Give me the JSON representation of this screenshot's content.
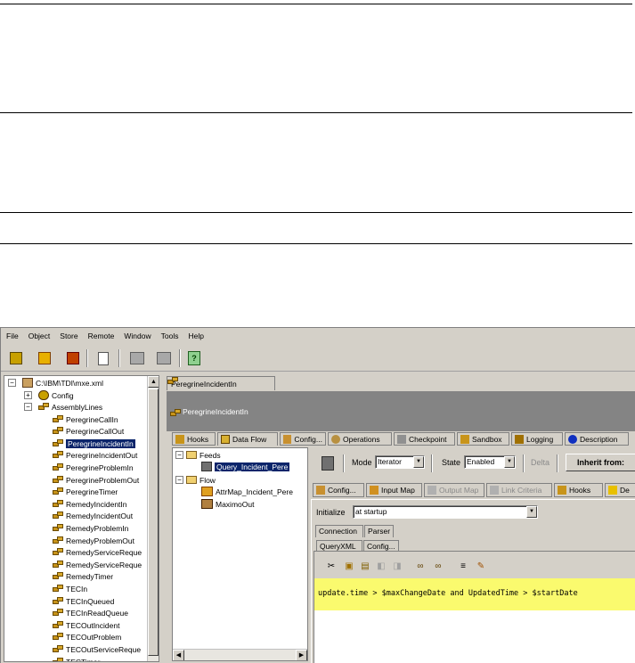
{
  "menu": [
    "File",
    "Object",
    "Store",
    "Remote",
    "Window",
    "Tools",
    "Help"
  ],
  "tree": {
    "root": "C:\\IBM\\TDI\\mxe.xml",
    "config": "Config",
    "assemblylines": "AssemblyLines",
    "items": [
      "PeregrineCallIn",
      "PeregrineCallOut",
      "PeregrineIncidentIn",
      "PeregrineIncidentOut",
      "PeregrineProblemIn",
      "PeregrineProblemOut",
      "PeregrineTimer",
      "RemedyIncidentIn",
      "RemedyIncidentOut",
      "RemedyProblemIn",
      "RemedyProblemOut",
      "RemedyServiceReque",
      "RemedyServiceReque",
      "RemedyTimer",
      "TECIn",
      "TECInQueued",
      "TECInReadQueue",
      "TECOutIncident",
      "TECOutProblem",
      "TECOutServiceReque",
      "TECTimer"
    ],
    "selected_index": 2
  },
  "editor_tab": "PeregrineIncidentIn",
  "header_title": "PeregrineIncidentIn",
  "main_tabs": [
    "Hooks",
    "Data Flow",
    "Config...",
    "Operations",
    "Checkpoint",
    "Sandbox",
    "Logging",
    "Description"
  ],
  "flow": {
    "feeds_label": "Feeds",
    "feeds_item": "Query_Incident_Pere",
    "flow_label": "Flow",
    "flow_items": [
      "AttrMap_Incident_Pere",
      "MaximoOut"
    ]
  },
  "controls": {
    "mode_label": "Mode",
    "mode_value": "Iterator",
    "state_label": "State",
    "state_value": "Enabled",
    "delta_label": "Delta",
    "inherit_label": "Inherit from:"
  },
  "sub_tabs": [
    "Config...",
    "Input Map",
    "Output Map",
    "Link Criteria",
    "Hooks",
    "De"
  ],
  "initialize_label": "Initialize",
  "initialize_value": "at startup",
  "panel_tabs": [
    "Connection",
    "Parser"
  ],
  "inner_tabs": [
    "QueryXML",
    "Config..."
  ],
  "code_line": "update.time > $maxChangeDate and UpdatedTime > $startDate",
  "colors": {
    "highlight": "#fafa6e",
    "selection": "#0a246a",
    "header": "#848484"
  }
}
